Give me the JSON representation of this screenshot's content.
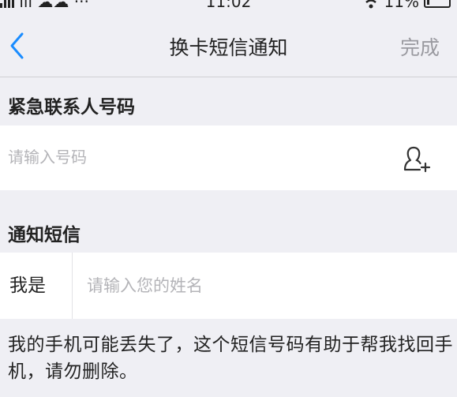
{
  "status_bar": {
    "left_text": "ılı ☁☁ ···",
    "time": "11:02",
    "battery": "11%"
  },
  "nav": {
    "title": "换卡短信通知",
    "done_label": "完成"
  },
  "emergency": {
    "header": "紧急联系人号码",
    "phone_placeholder": "请输入号码",
    "phone_value": ""
  },
  "notify": {
    "header": "通知短信",
    "me_label": "我是",
    "name_placeholder": "请输入您的姓名",
    "name_value": "",
    "message": "我的手机可能丢失了，这个短信号码有助于帮我找回手机，请勿删除。"
  },
  "icons": {
    "back": "chevron-left-icon",
    "add_contact": "add-contact-icon",
    "wifi": "wifi-icon",
    "battery": "battery-icon"
  },
  "colors": {
    "accent": "#1a8cff",
    "background": "#efeff4",
    "placeholder": "#b4b4b8",
    "done_disabled": "#9a9aa0"
  }
}
